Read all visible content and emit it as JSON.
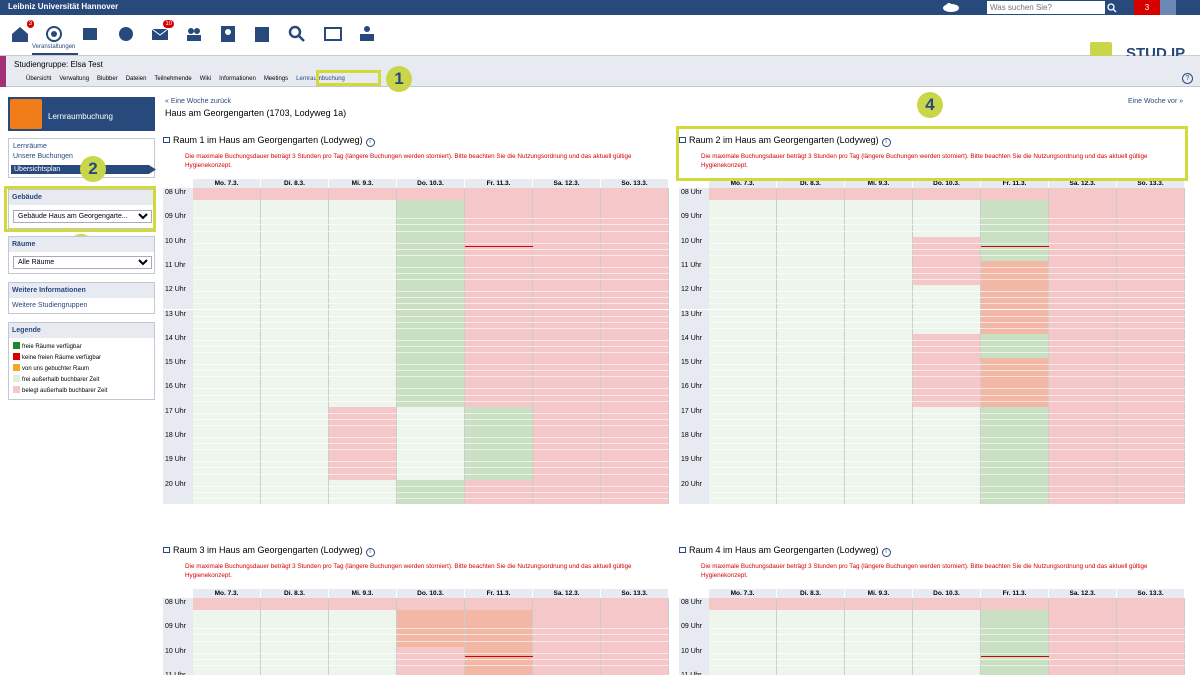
{
  "topbar": {
    "university": "Leibniz Universität Hannover",
    "search_placeholder": "Was suchen Sie?",
    "notifications": "3"
  },
  "nav": {
    "active_label": "Veranstaltungen",
    "icons": [
      "home-icon",
      "courses-icon",
      "workplace-icon",
      "community-icon",
      "messages-icon",
      "contacts-icon",
      "profile-icon",
      "schedule-icon",
      "search-icon",
      "resources-icon",
      "tools-icon"
    ],
    "badges": {
      "home": "3",
      "messages": "10"
    }
  },
  "brand": {
    "name": "STUD.IP"
  },
  "context": {
    "title": "Studiengruppe: Elsa Test",
    "tabs": [
      "Übersicht",
      "Verwaltung",
      "Blubber",
      "Dateien",
      "Teilnehmende",
      "Wiki",
      "Informationen",
      "Meetings",
      "Lernraumbuchung"
    ],
    "active_tab": "Lernraumbuchung"
  },
  "annotations": [
    "1",
    "2",
    "3",
    "4"
  ],
  "sidebar": {
    "header": "Lernraumbuchung",
    "links": [
      "Lernräume",
      "Unsere Buchungen",
      "Übersichtsplan"
    ],
    "building_label": "Gebäude",
    "building_value": "Gebäude Haus am Georgengarte...",
    "rooms_label": "Räume",
    "rooms_value": "Alle Räume",
    "more_info": "Weitere Informationen",
    "more_groups": "Weitere Studiengruppen",
    "legend_title": "Legende",
    "legend": [
      {
        "label": "freie Räume verfügbar",
        "color": "#1d8a2a"
      },
      {
        "label": "keine freien Räume verfügbar",
        "color": "#d60000"
      },
      {
        "label": "von uns gebuchter Raum",
        "color": "#f5a623"
      },
      {
        "label": "frei außerhalb buchbarer Zeit",
        "color": "#dfeedd"
      },
      {
        "label": "belegt außerhalb buchbarer Zeit",
        "color": "#f5c7c9"
      }
    ]
  },
  "main": {
    "back": "Eine Woche zurück",
    "forward": "Eine Woche vor",
    "title": "Haus am Georgengarten (1703, Lodyweg 1a)"
  },
  "days": [
    "Mo. 7.3.",
    "Di. 8.3.",
    "Mi. 9.3.",
    "Do. 10.3.",
    "Fr. 11.3.",
    "Sa. 12.3.",
    "So. 13.3."
  ],
  "hours": [
    "08 Uhr",
    "09 Uhr",
    "10 Uhr",
    "11 Uhr",
    "12 Uhr",
    "13 Uhr",
    "14 Uhr",
    "15 Uhr",
    "16 Uhr",
    "17 Uhr",
    "18 Uhr",
    "19 Uhr",
    "20 Uhr"
  ],
  "warning": "Die maximale Buchungsdauer beträgt 3 Stunden pro Tag (längere Buchungen werden storniert). Bitte beachten Sie die Nutzungsordnung und das aktuell gültige Hygienekonzept.",
  "colors": {
    "free": "#eef5ec",
    "freebook": "#c9e1c2",
    "busy": "#f5c7c9",
    "mine": "#f3b7a6"
  },
  "rooms": [
    {
      "title": "Raum 1 im Haus am Georgengarten (Lodyweg)",
      "cells": [
        "bbbbbbb",
        "fffgbbb",
        "fffgbbb",
        "fffgbbb",
        "fffgbbb",
        "fffgbbb",
        "fffgbbb",
        "fffgbbb",
        "fffgbbb",
        "ffbfgbb",
        "ffbfgbb",
        "ffbfgbb",
        "fffgbbb"
      ]
    },
    {
      "title": "Raum 2 im Haus am Georgengarten (Lodyweg)",
      "cells": [
        "bbbbbbb",
        "ffffgbb",
        "fffbgbb",
        "fffbmbb",
        "ffffmbb",
        "ffffmbb",
        "fffbgbb",
        "fffbmbb",
        "fffbmbb",
        "ffffgbb",
        "ffffgbb",
        "ffffgbb",
        "ffffgbb"
      ]
    },
    {
      "title": "Raum 3 im Haus am Georgengarten (Lodyweg)",
      "cells": [
        "bbbbbbb",
        "fffmmbb",
        "fffbmbb",
        "fffbmbb"
      ]
    },
    {
      "title": "Raum 4 im Haus am Georgengarten (Lodyweg)",
      "cells": [
        "bbbbbbb",
        "ffffgbb",
        "ffffgbb",
        "ffffgbb"
      ]
    }
  ]
}
